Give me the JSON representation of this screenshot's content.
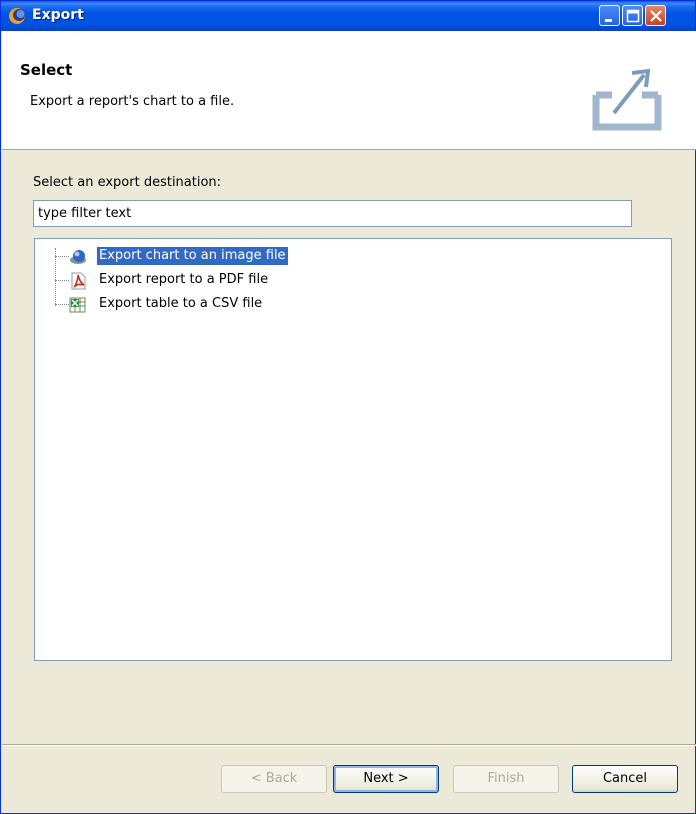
{
  "window": {
    "title": "Export",
    "app_icon": "eclipse-icon"
  },
  "titlebar_buttons": [
    "minimize-icon",
    "maximize-icon",
    "close-icon"
  ],
  "header": {
    "title": "Select",
    "description": "Export a report's chart to a file.",
    "icon": "export-icon"
  },
  "body": {
    "destination_label": "Select an export destination:",
    "filter_value": "type filter text"
  },
  "tree": {
    "items": [
      {
        "label": "Export chart to an image file",
        "icon": "image-export-icon",
        "selected": true
      },
      {
        "label": "Export report to a PDF file",
        "icon": "pdf-icon",
        "selected": false
      },
      {
        "label": "Export table to a CSV file",
        "icon": "csv-icon",
        "selected": false
      }
    ]
  },
  "buttons": {
    "back": "< Back",
    "next": "Next >",
    "finish": "Finish",
    "cancel": "Cancel"
  },
  "colors": {
    "titlebar": "#0055e5",
    "selection": "#316ac5",
    "dialog_bg": "#ece9d8"
  }
}
